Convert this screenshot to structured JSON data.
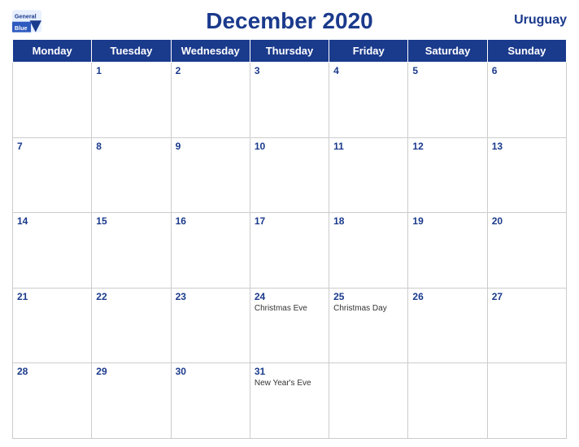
{
  "header": {
    "title": "December 2020",
    "country": "Uruguay",
    "logo_line1": "General",
    "logo_line2": "Blue"
  },
  "days_of_week": [
    "Monday",
    "Tuesday",
    "Wednesday",
    "Thursday",
    "Friday",
    "Saturday",
    "Sunday"
  ],
  "weeks": [
    [
      {
        "day": "",
        "event": ""
      },
      {
        "day": "1",
        "event": ""
      },
      {
        "day": "2",
        "event": ""
      },
      {
        "day": "3",
        "event": ""
      },
      {
        "day": "4",
        "event": ""
      },
      {
        "day": "5",
        "event": ""
      },
      {
        "day": "6",
        "event": ""
      }
    ],
    [
      {
        "day": "7",
        "event": ""
      },
      {
        "day": "8",
        "event": ""
      },
      {
        "day": "9",
        "event": ""
      },
      {
        "day": "10",
        "event": ""
      },
      {
        "day": "11",
        "event": ""
      },
      {
        "day": "12",
        "event": ""
      },
      {
        "day": "13",
        "event": ""
      }
    ],
    [
      {
        "day": "14",
        "event": ""
      },
      {
        "day": "15",
        "event": ""
      },
      {
        "day": "16",
        "event": ""
      },
      {
        "day": "17",
        "event": ""
      },
      {
        "day": "18",
        "event": ""
      },
      {
        "day": "19",
        "event": ""
      },
      {
        "day": "20",
        "event": ""
      }
    ],
    [
      {
        "day": "21",
        "event": ""
      },
      {
        "day": "22",
        "event": ""
      },
      {
        "day": "23",
        "event": ""
      },
      {
        "day": "24",
        "event": "Christmas Eve"
      },
      {
        "day": "25",
        "event": "Christmas Day"
      },
      {
        "day": "26",
        "event": ""
      },
      {
        "day": "27",
        "event": ""
      }
    ],
    [
      {
        "day": "28",
        "event": ""
      },
      {
        "day": "29",
        "event": ""
      },
      {
        "day": "30",
        "event": ""
      },
      {
        "day": "31",
        "event": "New Year's Eve"
      },
      {
        "day": "",
        "event": ""
      },
      {
        "day": "",
        "event": ""
      },
      {
        "day": "",
        "event": ""
      }
    ]
  ]
}
